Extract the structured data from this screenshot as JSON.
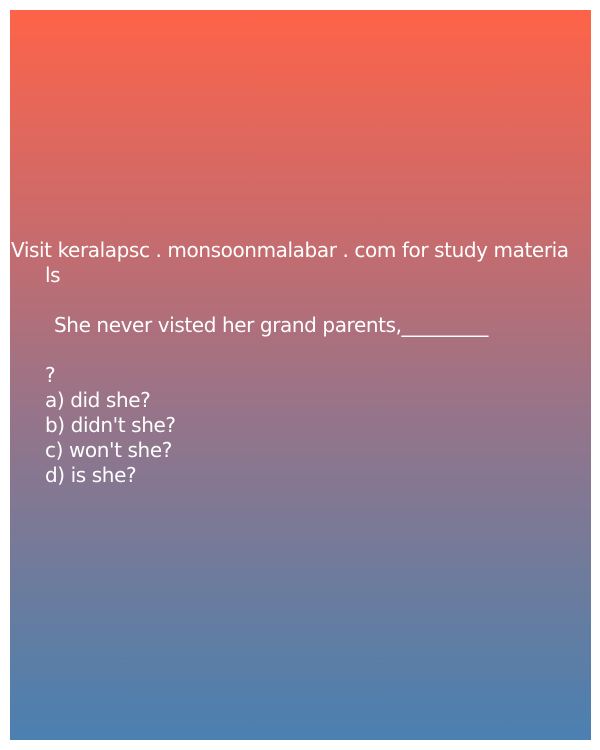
{
  "header": {
    "line1": "Visit keralapsc . monsoonmalabar . com for study materia",
    "line2": "ls"
  },
  "question": {
    "text": "She never visted her grand parents,_________",
    "mark": "?"
  },
  "options": [
    "a) did she?",
    "b) didn't she?",
    "c) won't she?",
    "d) is she?"
  ],
  "colors": {
    "gradient_top": "#fe6348",
    "gradient_bottom": "#4b80b1",
    "text": "#ffffff"
  }
}
